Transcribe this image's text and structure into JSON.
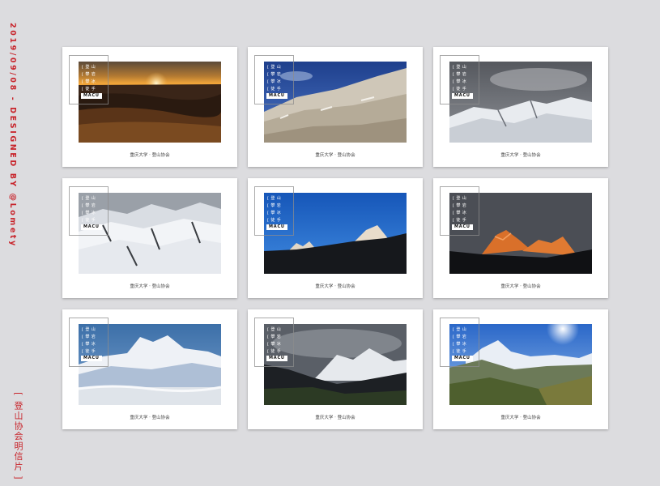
{
  "side_date": "2019/09/08 - DESIGNED BY @Lomety",
  "side_title": "[ 登山协会明信片 ]",
  "card": {
    "tags": [
      "[ 登 山",
      "[ 攀 岩",
      "[ 攀 冰",
      "[ 徒 手"
    ],
    "badge": "MACU",
    "caption": "重庆大学 · 登山协会"
  },
  "cards": [
    {
      "scene": "sunset over desert hills"
    },
    {
      "scene": "snowy hillside under blue sky"
    },
    {
      "scene": "snow peaks under grey clouds"
    },
    {
      "scene": "snow-covered mountain range"
    },
    {
      "scene": "sunlit peaks at dusk, blue sky"
    },
    {
      "scene": "alpenglow orange peaks"
    },
    {
      "scene": "snow massif above sea of clouds"
    },
    {
      "scene": "cloudy peaks over dark valley"
    },
    {
      "scene": "sunburst over snow peak and green valley"
    }
  ]
}
